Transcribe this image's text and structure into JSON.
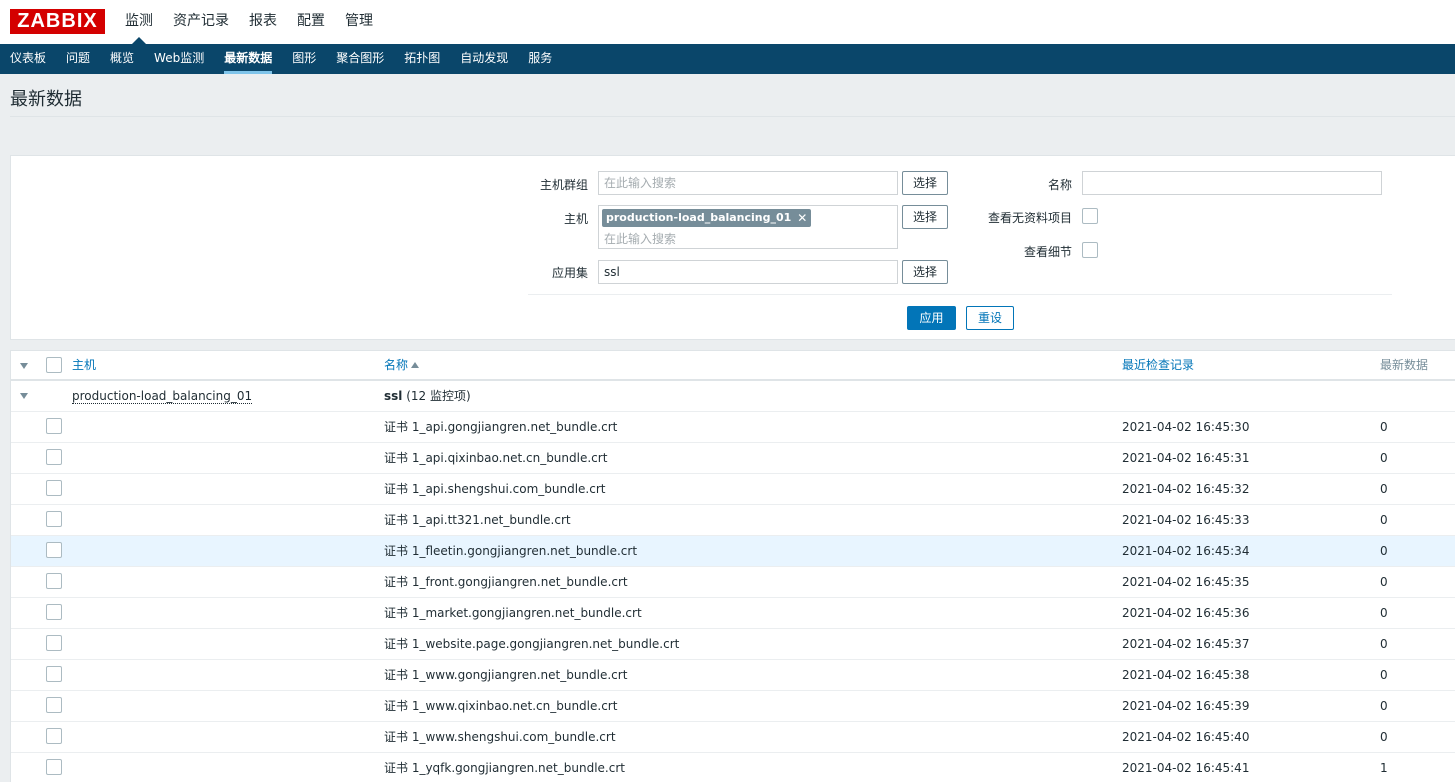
{
  "logo": "ZABBIX",
  "main_menu": [
    {
      "label": "监测",
      "active": true
    },
    {
      "label": "资产记录",
      "active": false
    },
    {
      "label": "报表",
      "active": false
    },
    {
      "label": "配置",
      "active": false
    },
    {
      "label": "管理",
      "active": false
    }
  ],
  "sub_menu": [
    {
      "label": "仪表板",
      "active": false
    },
    {
      "label": "问题",
      "active": false
    },
    {
      "label": "概览",
      "active": false
    },
    {
      "label": "Web监测",
      "active": false
    },
    {
      "label": "最新数据",
      "active": true
    },
    {
      "label": "图形",
      "active": false
    },
    {
      "label": "聚合图形",
      "active": false
    },
    {
      "label": "拓扑图",
      "active": false
    },
    {
      "label": "自动发现",
      "active": false
    },
    {
      "label": "服务",
      "active": false
    }
  ],
  "page_title": "最新数据",
  "filter": {
    "host_group_label": "主机群组",
    "host_group_placeholder": "在此输入搜索",
    "host_label": "主机",
    "host_tag": "production-load_balancing_01",
    "host_placeholder": "在此输入搜索",
    "app_label": "应用集",
    "app_value": "ssl",
    "select_label": "选择",
    "name_label": "名称",
    "name_value": "",
    "show_without_data_label": "查看无资料项目",
    "show_details_label": "查看细节",
    "apply_label": "应用",
    "reset_label": "重设"
  },
  "table": {
    "col_host": "主机",
    "col_name": "名称",
    "col_lastcheck": "最近检查记录",
    "col_lastvalue": "最新数据",
    "group_host": "production-load_balancing_01",
    "group_app": "ssl",
    "group_count": "(12 监控项)",
    "rows": [
      {
        "name": "证书 1_api.gongjiangren.net_bundle.crt",
        "time": "2021-04-02 16:45:30",
        "value": "0"
      },
      {
        "name": "证书 1_api.qixinbao.net.cn_bundle.crt",
        "time": "2021-04-02 16:45:31",
        "value": "0"
      },
      {
        "name": "证书 1_api.shengshui.com_bundle.crt",
        "time": "2021-04-02 16:45:32",
        "value": "0"
      },
      {
        "name": "证书 1_api.tt321.net_bundle.crt",
        "time": "2021-04-02 16:45:33",
        "value": "0"
      },
      {
        "name": "证书 1_fleetin.gongjiangren.net_bundle.crt",
        "time": "2021-04-02 16:45:34",
        "value": "0"
      },
      {
        "name": "证书 1_front.gongjiangren.net_bundle.crt",
        "time": "2021-04-02 16:45:35",
        "value": "0"
      },
      {
        "name": "证书 1_market.gongjiangren.net_bundle.crt",
        "time": "2021-04-02 16:45:36",
        "value": "0"
      },
      {
        "name": "证书 1_website.page.gongjiangren.net_bundle.crt",
        "time": "2021-04-02 16:45:37",
        "value": "0"
      },
      {
        "name": "证书 1_www.gongjiangren.net_bundle.crt",
        "time": "2021-04-02 16:45:38",
        "value": "0"
      },
      {
        "name": "证书 1_www.qixinbao.net.cn_bundle.crt",
        "time": "2021-04-02 16:45:39",
        "value": "0"
      },
      {
        "name": "证书 1_www.shengshui.com_bundle.crt",
        "time": "2021-04-02 16:45:40",
        "value": "0"
      },
      {
        "name": "证书 1_yqfk.gongjiangren.net_bundle.crt",
        "time": "2021-04-02 16:45:41",
        "value": "1"
      }
    ]
  },
  "colors": {
    "brand_red": "#d40000",
    "nav_blue": "#0a466a",
    "link_blue": "#0275b8",
    "row_highlight": "#e8f5ff"
  }
}
